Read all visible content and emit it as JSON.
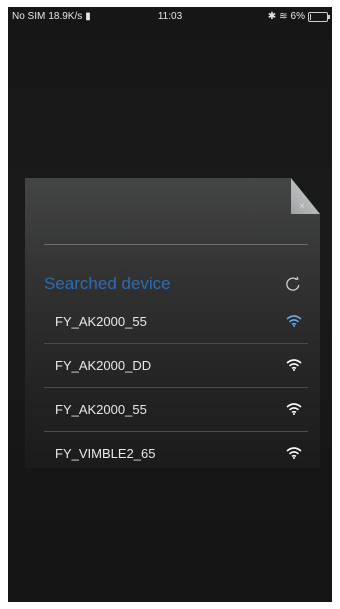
{
  "status_bar": {
    "carrier": "No SIM",
    "speed": "18.9K/s",
    "time": "11:03",
    "battery": "6%",
    "battery_level": 0.06
  },
  "dialog": {
    "title": "Searched device",
    "devices": [
      {
        "name": "FY_AK2000_55",
        "icon": "wifi-icon",
        "color": "#6aa7e6"
      },
      {
        "name": "FY_AK2000_DD",
        "icon": "wifi-icon",
        "color": "#ffffff"
      },
      {
        "name": "FY_AK2000_55",
        "icon": "wifi-icon",
        "color": "#ffffff"
      },
      {
        "name": "FY_VIMBLE2_65",
        "icon": "wifi-icon",
        "color": "#ffffff"
      }
    ]
  },
  "colors": {
    "accent": "#2f6bb2",
    "background": "#161616"
  }
}
